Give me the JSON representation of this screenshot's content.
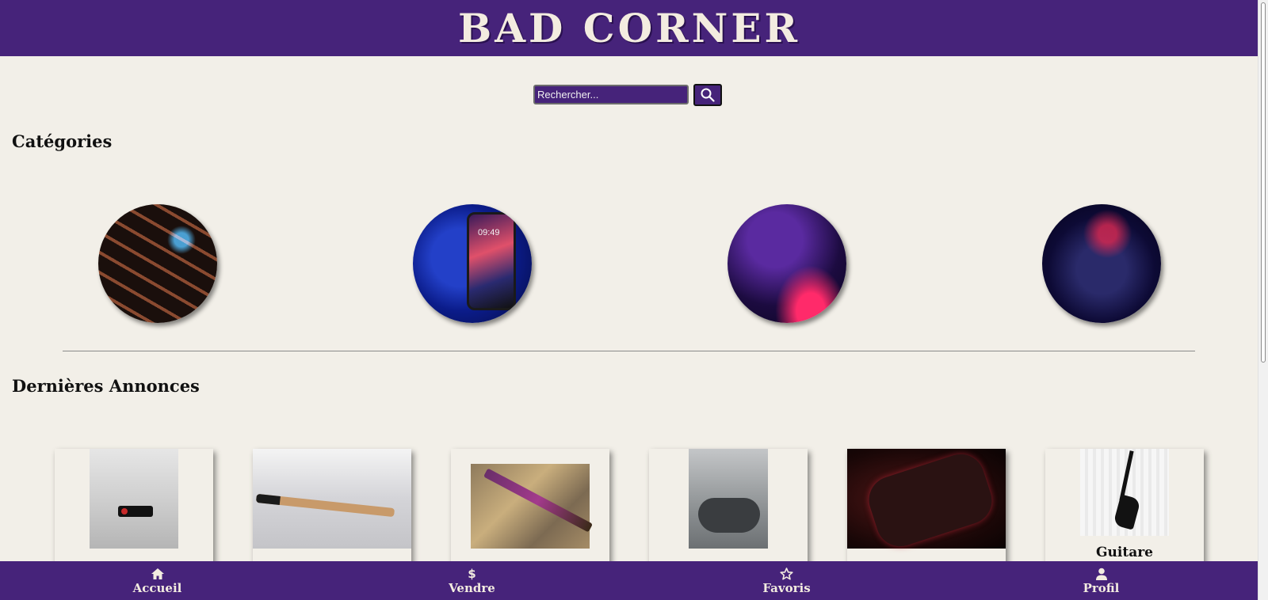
{
  "header": {
    "logo": "BAD CORNER"
  },
  "search": {
    "placeholder": "Rechercher...",
    "value": ""
  },
  "categories": {
    "title": "Catégories",
    "items": [
      {
        "icon": "keyboard-image"
      },
      {
        "icon": "smartphone-image",
        "phone_time": "09:49"
      },
      {
        "icon": "dj-mixer-image"
      },
      {
        "icon": "gamepad-image"
      }
    ]
  },
  "ads": {
    "title": "Dernières Annonces",
    "items": [
      {
        "icon": "usb-stick-image",
        "title": ""
      },
      {
        "icon": "pen-image",
        "title": ""
      },
      {
        "icon": "stick-image",
        "title": ""
      },
      {
        "icon": "xbox-controller-image",
        "title": ""
      },
      {
        "icon": "ps-controller-image",
        "title": ""
      },
      {
        "icon": "guitar-image",
        "title": "Guitare"
      }
    ]
  },
  "bottom_nav": {
    "items": [
      {
        "label": "Accueil",
        "icon": "home-icon"
      },
      {
        "label": "Vendre",
        "icon": "dollar-icon",
        "glyph": "$"
      },
      {
        "label": "Favoris",
        "icon": "star-icon"
      },
      {
        "label": "Profil",
        "icon": "user-icon"
      }
    ]
  },
  "colors": {
    "brand": "#46237a",
    "background": "#f2efe8",
    "text_light": "#f3ece0"
  }
}
